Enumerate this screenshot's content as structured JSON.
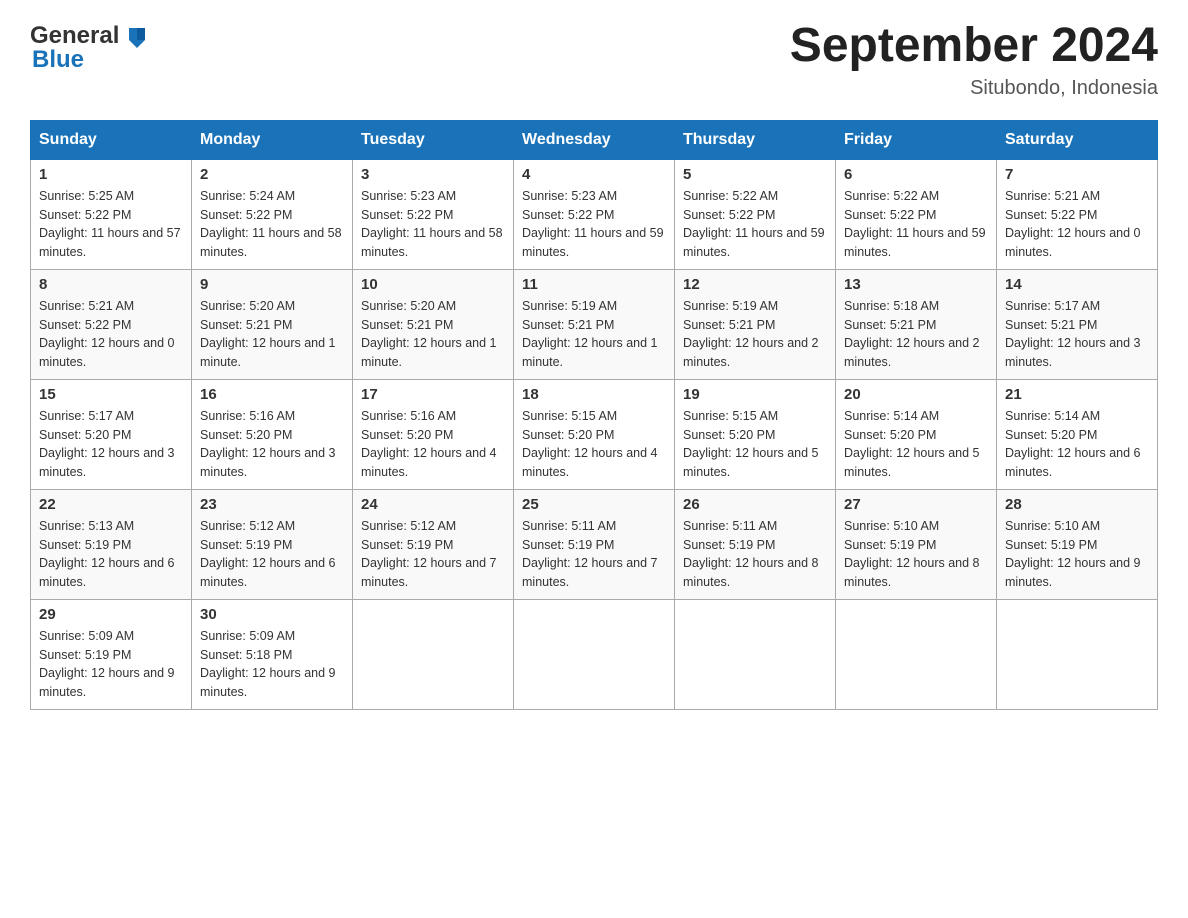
{
  "header": {
    "logo_general": "General",
    "logo_blue": "Blue",
    "title": "September 2024",
    "subtitle": "Situbondo, Indonesia"
  },
  "weekdays": [
    "Sunday",
    "Monday",
    "Tuesday",
    "Wednesday",
    "Thursday",
    "Friday",
    "Saturday"
  ],
  "weeks": [
    [
      {
        "day": "1",
        "sunrise": "5:25 AM",
        "sunset": "5:22 PM",
        "daylight": "11 hours and 57 minutes."
      },
      {
        "day": "2",
        "sunrise": "5:24 AM",
        "sunset": "5:22 PM",
        "daylight": "11 hours and 58 minutes."
      },
      {
        "day": "3",
        "sunrise": "5:23 AM",
        "sunset": "5:22 PM",
        "daylight": "11 hours and 58 minutes."
      },
      {
        "day": "4",
        "sunrise": "5:23 AM",
        "sunset": "5:22 PM",
        "daylight": "11 hours and 59 minutes."
      },
      {
        "day": "5",
        "sunrise": "5:22 AM",
        "sunset": "5:22 PM",
        "daylight": "11 hours and 59 minutes."
      },
      {
        "day": "6",
        "sunrise": "5:22 AM",
        "sunset": "5:22 PM",
        "daylight": "11 hours and 59 minutes."
      },
      {
        "day": "7",
        "sunrise": "5:21 AM",
        "sunset": "5:22 PM",
        "daylight": "12 hours and 0 minutes."
      }
    ],
    [
      {
        "day": "8",
        "sunrise": "5:21 AM",
        "sunset": "5:22 PM",
        "daylight": "12 hours and 0 minutes."
      },
      {
        "day": "9",
        "sunrise": "5:20 AM",
        "sunset": "5:21 PM",
        "daylight": "12 hours and 1 minute."
      },
      {
        "day": "10",
        "sunrise": "5:20 AM",
        "sunset": "5:21 PM",
        "daylight": "12 hours and 1 minute."
      },
      {
        "day": "11",
        "sunrise": "5:19 AM",
        "sunset": "5:21 PM",
        "daylight": "12 hours and 1 minute."
      },
      {
        "day": "12",
        "sunrise": "5:19 AM",
        "sunset": "5:21 PM",
        "daylight": "12 hours and 2 minutes."
      },
      {
        "day": "13",
        "sunrise": "5:18 AM",
        "sunset": "5:21 PM",
        "daylight": "12 hours and 2 minutes."
      },
      {
        "day": "14",
        "sunrise": "5:17 AM",
        "sunset": "5:21 PM",
        "daylight": "12 hours and 3 minutes."
      }
    ],
    [
      {
        "day": "15",
        "sunrise": "5:17 AM",
        "sunset": "5:20 PM",
        "daylight": "12 hours and 3 minutes."
      },
      {
        "day": "16",
        "sunrise": "5:16 AM",
        "sunset": "5:20 PM",
        "daylight": "12 hours and 3 minutes."
      },
      {
        "day": "17",
        "sunrise": "5:16 AM",
        "sunset": "5:20 PM",
        "daylight": "12 hours and 4 minutes."
      },
      {
        "day": "18",
        "sunrise": "5:15 AM",
        "sunset": "5:20 PM",
        "daylight": "12 hours and 4 minutes."
      },
      {
        "day": "19",
        "sunrise": "5:15 AM",
        "sunset": "5:20 PM",
        "daylight": "12 hours and 5 minutes."
      },
      {
        "day": "20",
        "sunrise": "5:14 AM",
        "sunset": "5:20 PM",
        "daylight": "12 hours and 5 minutes."
      },
      {
        "day": "21",
        "sunrise": "5:14 AM",
        "sunset": "5:20 PM",
        "daylight": "12 hours and 6 minutes."
      }
    ],
    [
      {
        "day": "22",
        "sunrise": "5:13 AM",
        "sunset": "5:19 PM",
        "daylight": "12 hours and 6 minutes."
      },
      {
        "day": "23",
        "sunrise": "5:12 AM",
        "sunset": "5:19 PM",
        "daylight": "12 hours and 6 minutes."
      },
      {
        "day": "24",
        "sunrise": "5:12 AM",
        "sunset": "5:19 PM",
        "daylight": "12 hours and 7 minutes."
      },
      {
        "day": "25",
        "sunrise": "5:11 AM",
        "sunset": "5:19 PM",
        "daylight": "12 hours and 7 minutes."
      },
      {
        "day": "26",
        "sunrise": "5:11 AM",
        "sunset": "5:19 PM",
        "daylight": "12 hours and 8 minutes."
      },
      {
        "day": "27",
        "sunrise": "5:10 AM",
        "sunset": "5:19 PM",
        "daylight": "12 hours and 8 minutes."
      },
      {
        "day": "28",
        "sunrise": "5:10 AM",
        "sunset": "5:19 PM",
        "daylight": "12 hours and 9 minutes."
      }
    ],
    [
      {
        "day": "29",
        "sunrise": "5:09 AM",
        "sunset": "5:19 PM",
        "daylight": "12 hours and 9 minutes."
      },
      {
        "day": "30",
        "sunrise": "5:09 AM",
        "sunset": "5:18 PM",
        "daylight": "12 hours and 9 minutes."
      },
      null,
      null,
      null,
      null,
      null
    ]
  ]
}
